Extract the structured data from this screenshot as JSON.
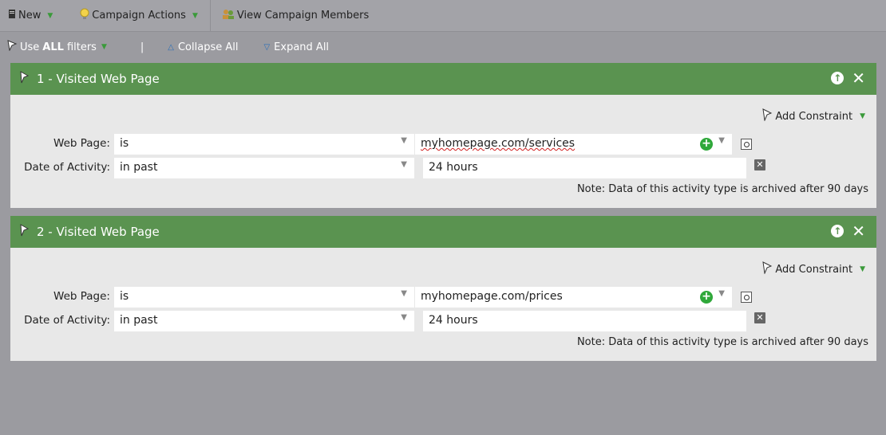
{
  "toolbar": {
    "new_label": "New",
    "campaign_actions_label": "Campaign Actions",
    "view_members_label": "View Campaign Members"
  },
  "filterbar": {
    "use_prefix": "Use",
    "use_all": "ALL",
    "use_suffix": "filters",
    "separator": "|",
    "collapse_label": "Collapse All",
    "expand_label": "Expand All"
  },
  "filters": [
    {
      "title": "1 - Visited Web Page",
      "add_constraint": "Add Constraint",
      "web_page_label": "Web Page:",
      "web_page_operator": "is",
      "web_page_value": "myhomepage.com/services",
      "date_label": "Date of Activity:",
      "date_operator": "in past",
      "date_value": "24 hours",
      "note": "Note: Data of this activity type is archived after 90 days"
    },
    {
      "title": "2 - Visited Web Page",
      "add_constraint": "Add Constraint",
      "web_page_label": "Web Page:",
      "web_page_operator": "is",
      "web_page_value": "myhomepage.com/prices",
      "date_label": "Date of Activity:",
      "date_operator": "in past",
      "date_value": "24 hours",
      "note": "Note: Data of this activity type is archived after 90 days"
    }
  ],
  "colors": {
    "header_green": "#5a9350",
    "background": "#9b9ba0",
    "panel": "#e8e8e8"
  }
}
